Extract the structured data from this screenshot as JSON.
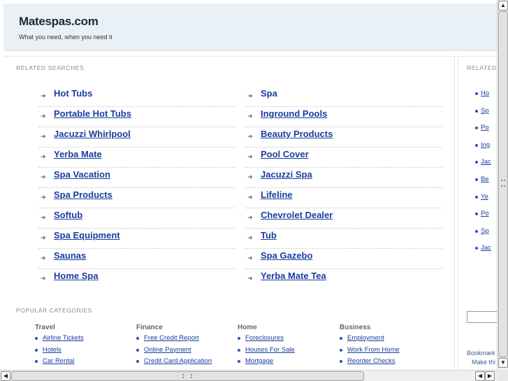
{
  "header": {
    "title": "Matespas.com",
    "tagline": "What you need, when you need it"
  },
  "related": {
    "label": "RELATED SEARCHES",
    "left": [
      "Hot Tubs",
      "Portable Hot Tubs",
      "Jacuzzi Whirlpool",
      "Yerba Mate",
      "Spa Vacation",
      "Spa Products",
      "Softub",
      "Spa Equipment",
      "Saunas",
      "Home Spa"
    ],
    "right": [
      "Spa",
      "Inground Pools",
      "Beauty Products",
      "Pool Cover",
      "Jacuzzi Spa",
      "Lifeline",
      "Chevrolet Dealer",
      "Tub",
      "Spa Gazebo",
      "Yerba Mate Tea"
    ]
  },
  "popular": {
    "label": "POPULAR CATEGORIES",
    "categories": [
      {
        "title": "Travel",
        "items": [
          "Airline Tickets",
          "Hotels",
          "Car Rental"
        ]
      },
      {
        "title": "Finance",
        "items": [
          "Free Credit Report",
          "Online Payment",
          "Credit Card Application"
        ]
      },
      {
        "title": "Home",
        "items": [
          "Foreclosures",
          "Houses For Sale",
          "Mortgage"
        ]
      },
      {
        "title": "Business",
        "items": [
          "Employment",
          "Work From Home",
          "Reorder Checks"
        ]
      }
    ]
  },
  "side": {
    "label": "RELATED",
    "items": [
      "Ho",
      "Sp",
      "Po",
      "Ing",
      "Jac",
      "Be",
      "Ye",
      "Po",
      "Sp",
      "Jac"
    ],
    "bookmark_1": "Bookmark",
    "bookmark_2": "Make thi"
  },
  "scrollbars": {
    "up_icon": "▲",
    "down_icon": "▼",
    "left_icon": "◀",
    "right_icon": "▶"
  },
  "colors": {
    "link": "#1a3c9e",
    "header_bg": "#e9f1f7",
    "arrow": "#3a6ea5"
  }
}
